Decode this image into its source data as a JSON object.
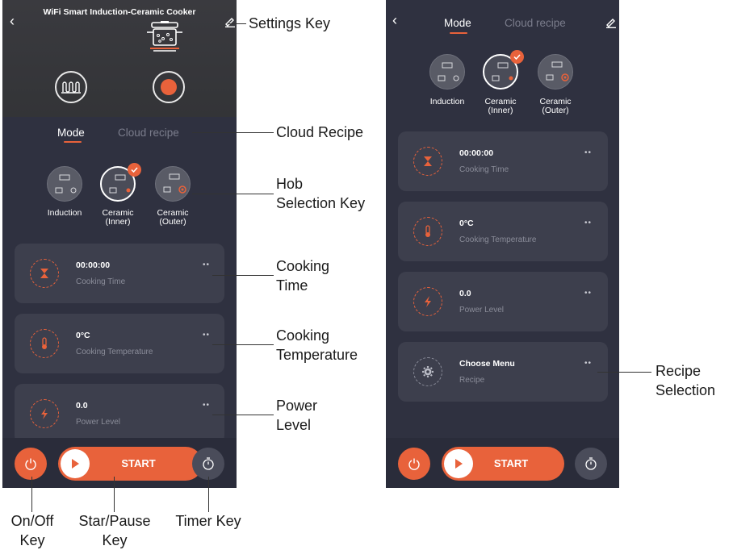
{
  "left_screen": {
    "title": "WiFi Smart Induction-Ceramic Cooker",
    "back_icon": "chevron-left-icon",
    "edit_icon": "pencil-icon",
    "tabs": [
      {
        "label": "Mode",
        "active": true
      },
      {
        "label": "Cloud recipe",
        "active": false
      }
    ],
    "hobs": [
      {
        "label_1": "Induction",
        "label_2": "",
        "selected": false
      },
      {
        "label_1": "Ceramic",
        "label_2": "(Inner)",
        "selected": true
      },
      {
        "label_1": "Ceramic",
        "label_2": "(Outer)",
        "selected": false
      }
    ],
    "cards": [
      {
        "value": "00:00:00",
        "label": "Cooking Time",
        "icon": "hourglass-icon",
        "dots": "••"
      },
      {
        "value": "0°C",
        "label": "Cooking Temperature",
        "icon": "thermometer-icon",
        "dots": "••"
      },
      {
        "value": "0.0",
        "label": "Power Level",
        "icon": "lightning-icon",
        "dots": "••"
      }
    ],
    "start_label": "START"
  },
  "right_screen": {
    "back_icon": "chevron-left-icon",
    "edit_icon": "pencil-icon",
    "tabs": [
      {
        "label": "Mode",
        "active": true
      },
      {
        "label": "Cloud recipe",
        "active": false
      }
    ],
    "hobs": [
      {
        "label_1": "Induction",
        "label_2": "",
        "selected": false
      },
      {
        "label_1": "Ceramic",
        "label_2": "(Inner)",
        "selected": true
      },
      {
        "label_1": "Ceramic",
        "label_2": "(Outer)",
        "selected": false
      }
    ],
    "cards": [
      {
        "value": "00:00:00",
        "label": "Cooking Time",
        "icon": "hourglass-icon",
        "dots": "••"
      },
      {
        "value": "0°C",
        "label": "Cooking Temperature",
        "icon": "thermometer-icon",
        "dots": "••"
      },
      {
        "value": "0.0",
        "label": "Power Level",
        "icon": "lightning-icon",
        "dots": "••"
      },
      {
        "value": "Choose Menu",
        "label": "Recipe",
        "icon": "gear-icon",
        "dots": "••"
      }
    ],
    "start_label": "START"
  },
  "annotations": {
    "settings_key": "Settings Key",
    "cloud_recipe": "Cloud Recipe",
    "hob_selection_1": "Hob",
    "hob_selection_2": "Selection Key",
    "cooking_time_1": "Cooking",
    "cooking_time_2": "Time",
    "cooking_temp_1": "Cooking",
    "cooking_temp_2": "Temperature",
    "power_level_1": "Power",
    "power_level_2": "Level",
    "recipe_selection_1": "Recipe",
    "recipe_selection_2": "Selection",
    "onoff_1": "On/Off",
    "onoff_2": "Key",
    "startpause_1": "Star/Pause",
    "startpause_2": "Key",
    "timer_key": "Timer Key"
  },
  "colors": {
    "accent": "#e8623b",
    "background": "#2f3140",
    "card": "#3d3f4d"
  }
}
